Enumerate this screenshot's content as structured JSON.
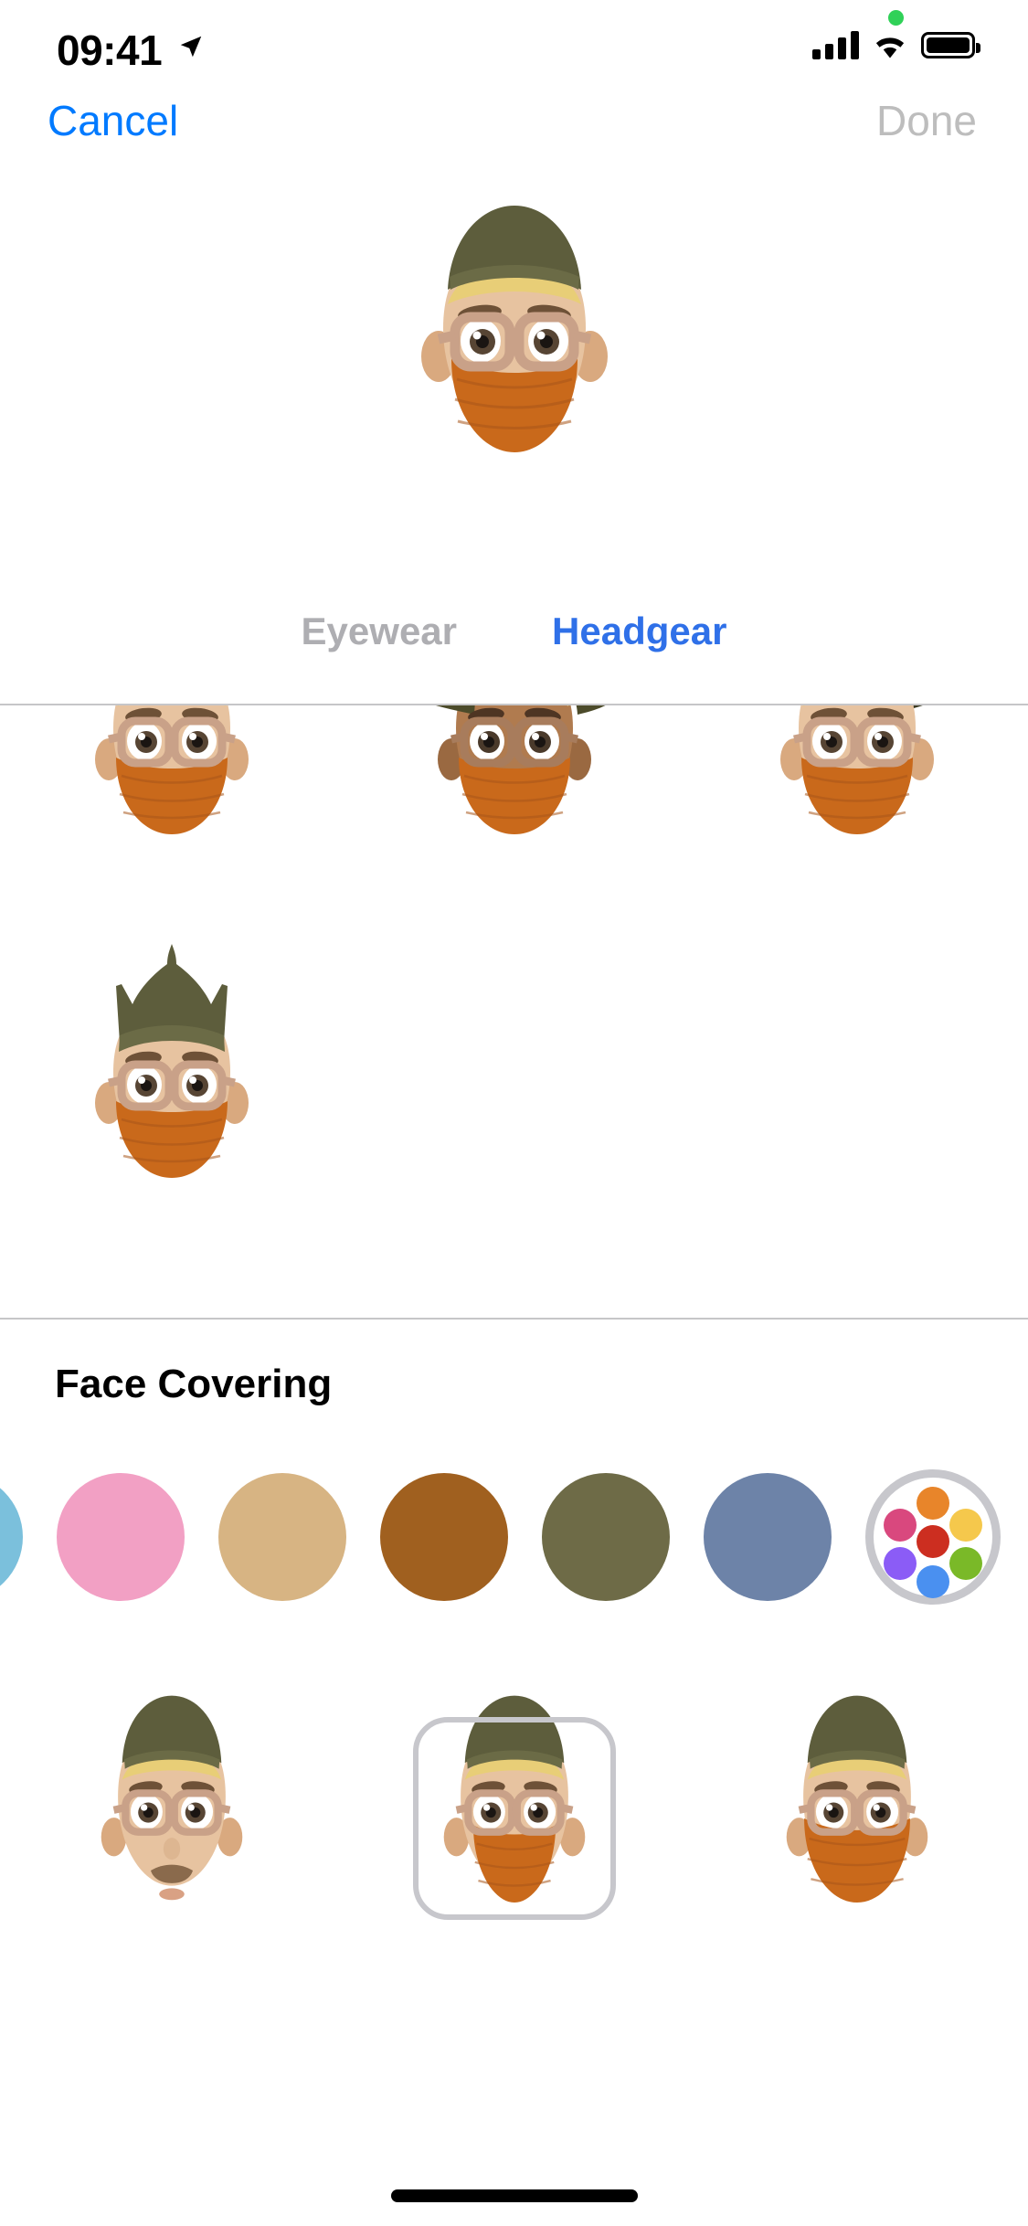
{
  "status_bar": {
    "time": "09:41",
    "location_icon": "location-arrow-icon",
    "recording_indicator": "green-privacy-dot",
    "cellular_icon": "signal-bars-icon",
    "wifi_icon": "wifi-icon",
    "battery_icon": "battery-full-icon"
  },
  "nav": {
    "cancel_label": "Cancel",
    "done_label": "Done",
    "cancel_color": "#007AFF",
    "done_color": "#BDBDBD",
    "done_enabled": false
  },
  "preview": {
    "name": "memoji-preview",
    "hat_color": "#5D5D3C",
    "hair_color": "#E8CE77",
    "skin_color": "#E7C3A0",
    "mask_color": "#C9691B",
    "glasses_color": "#C9A188"
  },
  "tabs": [
    {
      "label": "Eyewear",
      "active": false
    },
    {
      "label": "Headgear",
      "active": true
    }
  ],
  "headgear_grid": {
    "items": [
      {
        "name": "headgear-option-1",
        "hat_style": "wide-brim-hat",
        "hat_color": "#3B3A22",
        "skin_color": "#E7C3A0",
        "selected": false
      },
      {
        "name": "headgear-option-2",
        "hat_style": "wide-brim-hat-dark",
        "hat_color": "#4C4B2A",
        "skin_color": "#B07B4F",
        "selected": false
      },
      {
        "name": "headgear-option-3",
        "hat_style": "brim-hat-navy",
        "hat_color": "#262744",
        "skin_color": "#E7C3A0",
        "selected": false
      },
      {
        "name": "headgear-option-4",
        "hat_style": "viking-crown",
        "hat_color": "#5D5D3C",
        "skin_color": "#E7C3A0",
        "selected": false
      }
    ]
  },
  "face_covering": {
    "title": "Face Covering",
    "colors": [
      {
        "name": "swatch-light-blue",
        "hex": "#7BC0DC",
        "selected": false,
        "clipped": true
      },
      {
        "name": "swatch-pink",
        "hex": "#F2A0C4",
        "selected": false
      },
      {
        "name": "swatch-tan",
        "hex": "#D7B483",
        "selected": false
      },
      {
        "name": "swatch-brown",
        "hex": "#A0601F",
        "selected": false
      },
      {
        "name": "swatch-olive",
        "hex": "#6E6B47",
        "selected": false
      },
      {
        "name": "swatch-slate-blue",
        "hex": "#6D83A8",
        "selected": false
      }
    ],
    "multicolor_picker": {
      "name": "multicolor-picker",
      "selected": true,
      "ring_color": "#C7C7CC",
      "dots": [
        "#E8852A",
        "#D9487E",
        "#F5C council",
        "#CC2E20",
        "#8B5CF6",
        "#7AB928",
        "#4A90F0"
      ]
    },
    "options": [
      {
        "name": "face-covering-none",
        "has_mask": false,
        "mask_color": null,
        "selected": false
      },
      {
        "name": "face-covering-cloth",
        "has_mask": true,
        "mask_color": "#C9691B",
        "selected": true
      },
      {
        "name": "face-covering-wide",
        "has_mask": true,
        "mask_color": "#C9691B",
        "selected": false
      }
    ]
  },
  "home_indicator": {
    "name": "home-indicator"
  }
}
